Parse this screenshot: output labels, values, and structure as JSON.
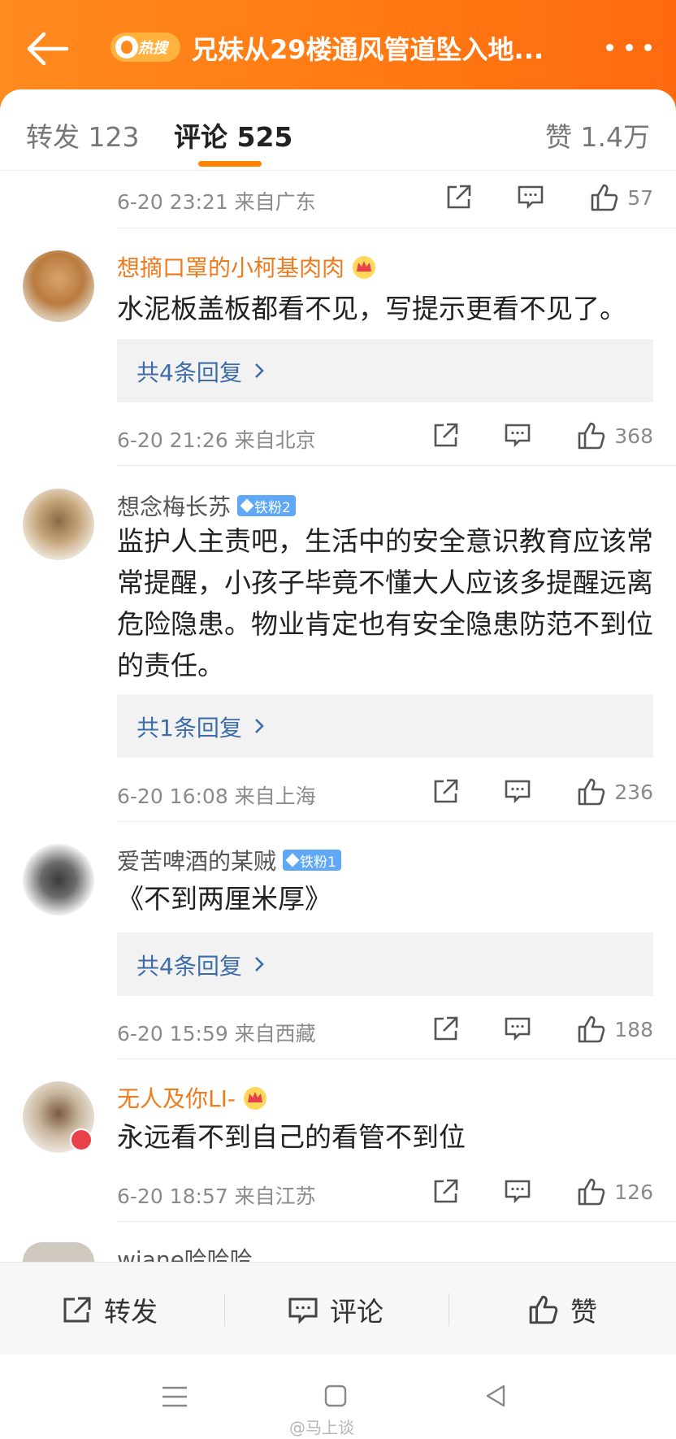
{
  "header": {
    "badge": "热搜",
    "title": "兄妹从29楼通风管道坠入地..."
  },
  "tabs": {
    "repost": "转发 123",
    "comment": "评论 525",
    "like": "赞 1.4万"
  },
  "accent_color": "#ff8200",
  "top_meta": {
    "time": "6-20 23:21  来自广东",
    "likes": "57"
  },
  "comments": [
    {
      "user": "想摘口罩的小柯基肉肉",
      "vip": true,
      "badge": "",
      "text": "水泥板盖板都看不见，写提示更看不见了。",
      "replies": "共4条回复",
      "time": "6-20 21:26  来自北京",
      "likes": "368"
    },
    {
      "user": "想念梅长苏",
      "vip": false,
      "badge": "铁粉2",
      "text": "监护人主责吧，生活中的安全意识教育应该常常提醒，小孩子毕竟不懂大人应该多提醒远离危险隐患。物业肯定也有安全隐患防范不到位的责任。",
      "replies": "共1条回复",
      "time": "6-20 16:08  来自上海",
      "likes": "236"
    },
    {
      "user": "爱苦啤酒的某贼",
      "vip": false,
      "badge": "铁粉1",
      "text": "《不到两厘米厚》",
      "replies": "共4条回复",
      "time": "6-20 15:59  来自西藏",
      "likes": "188"
    },
    {
      "user": "无人及你LI-",
      "vip": true,
      "badge": "",
      "text": "永远看不到自己的看管不到位",
      "replies": "",
      "time": "6-20 18:57  来自江苏",
      "likes": "126"
    },
    {
      "user": "wjane哈哈哈",
      "vip": false,
      "badge": "",
      "text": "",
      "replies": "",
      "time": "",
      "likes": ""
    }
  ],
  "bottom_bar": {
    "repost": "转发",
    "comment": "评论",
    "like": "赞"
  },
  "watermark": "@马上谈"
}
